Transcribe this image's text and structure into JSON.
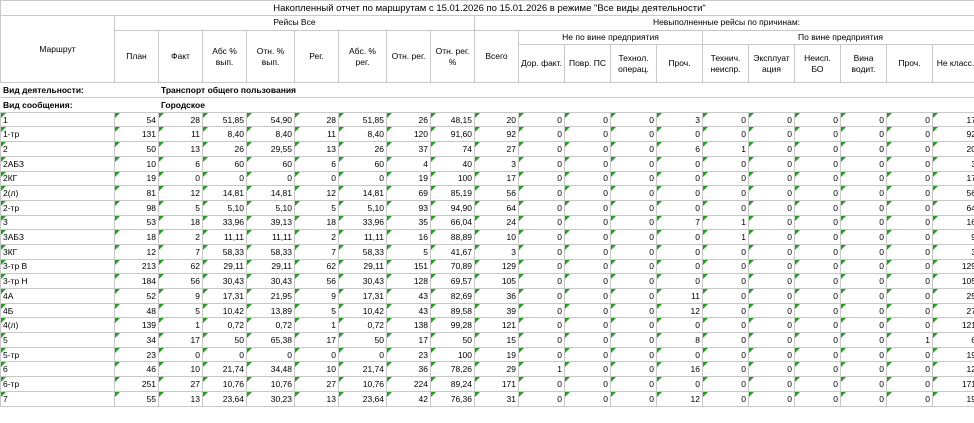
{
  "title": "Накопленный отчет по маршрутам с 15.01.2026 по 15.01.2026 в режиме \"Все виды деятельности\"",
  "headers": {
    "route": "Маршрут",
    "all_trips": "Рейсы Все",
    "not_done": "Невыполненные рейсы по причинам:",
    "not_fault": "Не по вине предприятия",
    "fault": "По вине предприятия",
    "plan": "План",
    "fact": "Факт",
    "abs_pct": "Абс % вып.",
    "rel_pct": "Отн. % вып.",
    "reg": "Рег.",
    "abs_reg_pct": "Абс. % рег.",
    "rel_reg": "Отн. рег.",
    "rel_reg_pct": "Отн. рег. %",
    "total": "Всего",
    "road_fact": "Дор. факт.",
    "damage_ps": "Повр. ПС",
    "tech_oper": "Технол. операц.",
    "other1": "Проч.",
    "tech_fault": "Технич. неиспр.",
    "exploitation": "Эксплуат ация",
    "fault_bo": "Неисп. БО",
    "driver_fault": "Вина водит.",
    "other2": "Проч.",
    "not_class": "Не класс."
  },
  "groups": {
    "activity_label": "Вид деятельности:",
    "activity_value": "Транспорт общего пользования",
    "service_label": "Вид сообщения:",
    "service_value": "Городское"
  },
  "rows": [
    [
      "1",
      "54",
      "28",
      "51,85",
      "54,90",
      "28",
      "51,85",
      "26",
      "48,15",
      "20",
      "0",
      "0",
      "0",
      "3",
      "0",
      "0",
      "0",
      "0",
      "0",
      "17"
    ],
    [
      "1-тр",
      "131",
      "11",
      "8,40",
      "8,40",
      "11",
      "8,40",
      "120",
      "91,60",
      "92",
      "0",
      "0",
      "0",
      "0",
      "0",
      "0",
      "0",
      "0",
      "0",
      "92"
    ],
    [
      "2",
      "50",
      "13",
      "26",
      "29,55",
      "13",
      "26",
      "37",
      "74",
      "27",
      "0",
      "0",
      "0",
      "6",
      "1",
      "0",
      "0",
      "0",
      "0",
      "20"
    ],
    [
      "2АБЗ",
      "10",
      "6",
      "60",
      "60",
      "6",
      "60",
      "4",
      "40",
      "3",
      "0",
      "0",
      "0",
      "0",
      "0",
      "0",
      "0",
      "0",
      "0",
      "3"
    ],
    [
      "2КГ",
      "19",
      "0",
      "0",
      "0",
      "0",
      "0",
      "19",
      "100",
      "17",
      "0",
      "0",
      "0",
      "0",
      "0",
      "0",
      "0",
      "0",
      "0",
      "17"
    ],
    [
      "2(л)",
      "81",
      "12",
      "14,81",
      "14,81",
      "12",
      "14,81",
      "69",
      "85,19",
      "56",
      "0",
      "0",
      "0",
      "0",
      "0",
      "0",
      "0",
      "0",
      "0",
      "56"
    ],
    [
      "2-тр",
      "98",
      "5",
      "5,10",
      "5,10",
      "5",
      "5,10",
      "93",
      "94,90",
      "64",
      "0",
      "0",
      "0",
      "0",
      "0",
      "0",
      "0",
      "0",
      "0",
      "64"
    ],
    [
      "3",
      "53",
      "18",
      "33,96",
      "39,13",
      "18",
      "33,96",
      "35",
      "66,04",
      "24",
      "0",
      "0",
      "0",
      "7",
      "1",
      "0",
      "0",
      "0",
      "0",
      "16"
    ],
    [
      "3АБЗ",
      "18",
      "2",
      "11,11",
      "11,11",
      "2",
      "11,11",
      "16",
      "88,89",
      "10",
      "0",
      "0",
      "0",
      "0",
      "1",
      "0",
      "0",
      "0",
      "0",
      "9"
    ],
    [
      "3КГ",
      "12",
      "7",
      "58,33",
      "58,33",
      "7",
      "58,33",
      "5",
      "41,67",
      "3",
      "0",
      "0",
      "0",
      "0",
      "0",
      "0",
      "0",
      "0",
      "0",
      "3"
    ],
    [
      "3-тр В",
      "213",
      "62",
      "29,11",
      "29,11",
      "62",
      "29,11",
      "151",
      "70,89",
      "129",
      "0",
      "0",
      "0",
      "0",
      "0",
      "0",
      "0",
      "0",
      "0",
      "129"
    ],
    [
      "3-тр Н",
      "184",
      "56",
      "30,43",
      "30,43",
      "56",
      "30,43",
      "128",
      "69,57",
      "105",
      "0",
      "0",
      "0",
      "0",
      "0",
      "0",
      "0",
      "0",
      "0",
      "105"
    ],
    [
      "4А",
      "52",
      "9",
      "17,31",
      "21,95",
      "9",
      "17,31",
      "43",
      "82,69",
      "36",
      "0",
      "0",
      "0",
      "11",
      "0",
      "0",
      "0",
      "0",
      "0",
      "25"
    ],
    [
      "4Б",
      "48",
      "5",
      "10,42",
      "13,89",
      "5",
      "10,42",
      "43",
      "89,58",
      "39",
      "0",
      "0",
      "0",
      "12",
      "0",
      "0",
      "0",
      "0",
      "0",
      "27"
    ],
    [
      "4(л)",
      "139",
      "1",
      "0,72",
      "0,72",
      "1",
      "0,72",
      "138",
      "99,28",
      "121",
      "0",
      "0",
      "0",
      "0",
      "0",
      "0",
      "0",
      "0",
      "0",
      "121"
    ],
    [
      "5",
      "34",
      "17",
      "50",
      "65,38",
      "17",
      "50",
      "17",
      "50",
      "15",
      "0",
      "0",
      "0",
      "8",
      "0",
      "0",
      "0",
      "0",
      "1",
      "6"
    ],
    [
      "5-тр",
      "23",
      "0",
      "0",
      "0",
      "0",
      "0",
      "23",
      "100",
      "19",
      "0",
      "0",
      "0",
      "0",
      "0",
      "0",
      "0",
      "0",
      "0",
      "19"
    ],
    [
      "6",
      "46",
      "10",
      "21,74",
      "34,48",
      "10",
      "21,74",
      "36",
      "78,26",
      "29",
      "1",
      "0",
      "0",
      "16",
      "0",
      "0",
      "0",
      "0",
      "0",
      "12"
    ],
    [
      "6-тр",
      "251",
      "27",
      "10,76",
      "10,76",
      "27",
      "10,76",
      "224",
      "89,24",
      "171",
      "0",
      "0",
      "0",
      "0",
      "0",
      "0",
      "0",
      "0",
      "0",
      "171"
    ],
    [
      "7",
      "55",
      "13",
      "23,64",
      "30,23",
      "13",
      "23,64",
      "42",
      "76,36",
      "31",
      "0",
      "0",
      "0",
      "12",
      "0",
      "0",
      "0",
      "0",
      "0",
      "19"
    ]
  ]
}
